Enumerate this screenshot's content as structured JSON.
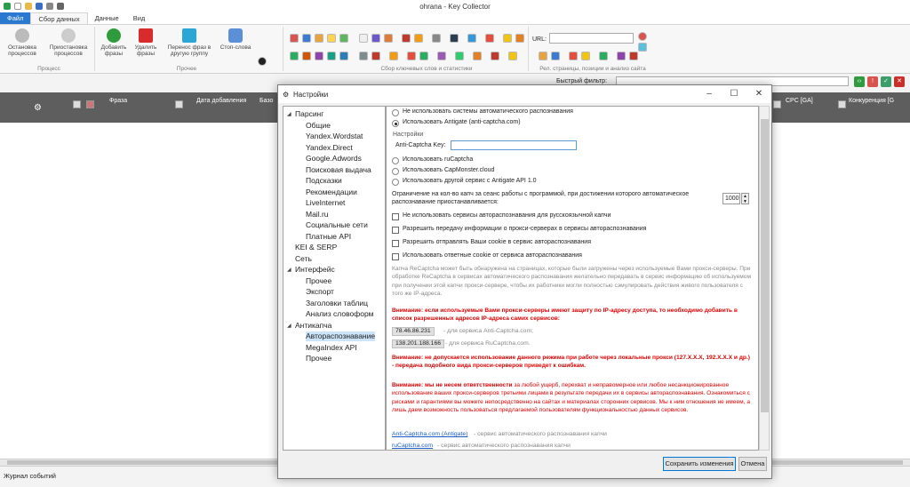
{
  "app": {
    "title": "ohrana - Key Collector"
  },
  "ribbon": {
    "tabs": [
      "Файл",
      "Сбор данных",
      "Данные",
      "Вид"
    ],
    "buttons": {
      "stop": "Остановка процессов",
      "pause": "Приостановка процессов",
      "add": "Добавить фразы",
      "delete": "Удалить фразы",
      "move": "Перенос фраз в другую группу",
      "stopwords": "Стоп-слова"
    },
    "groups": {
      "process": "Процесс",
      "other": "Прочее",
      "collect": "Сбор ключевых слов и статистики",
      "rel": "Рел. страницы, позиции и анализ сайта"
    },
    "url_label": "URL:"
  },
  "filter": {
    "label": "Быстрый фильтр:"
  },
  "grid": {
    "headers": {
      "phrase": "Фраза",
      "date": "Дата добавления",
      "base": "Базо",
      "cpc": "CPC [GA]",
      "competition": "Конкуренция [G"
    }
  },
  "status": {
    "journal": "Журнал событий"
  },
  "dialog": {
    "title": "Настройки",
    "tree": [
      {
        "label": "Парсинг",
        "level": 0,
        "expanded": true
      },
      {
        "label": "Общие",
        "level": 1
      },
      {
        "label": "Yandex.Wordstat",
        "level": 1
      },
      {
        "label": "Yandex.Direct",
        "level": 1
      },
      {
        "label": "Google.Adwords",
        "level": 1
      },
      {
        "label": "Поисковая выдача",
        "level": 1
      },
      {
        "label": "Подсказки",
        "level": 1
      },
      {
        "label": "Рекомендации",
        "level": 1
      },
      {
        "label": "LiveInternet",
        "level": 1
      },
      {
        "label": "Mail.ru",
        "level": 1
      },
      {
        "label": "Социальные сети",
        "level": 1
      },
      {
        "label": "Платные API",
        "level": 1
      },
      {
        "label": "KEI & SERP",
        "level": 0
      },
      {
        "label": "Сеть",
        "level": 0
      },
      {
        "label": "Интерфейс",
        "level": 0,
        "expanded": true
      },
      {
        "label": "Прочее",
        "level": 1
      },
      {
        "label": "Экспорт",
        "level": 1
      },
      {
        "label": "Заголовки таблиц",
        "level": 1
      },
      {
        "label": "Анализ словоформ",
        "level": 1
      },
      {
        "label": "Антикапча",
        "level": 0,
        "expanded": true
      },
      {
        "label": "Автораспознавание",
        "level": 1,
        "selected": true
      },
      {
        "label": "MegaIndex API",
        "level": 1
      },
      {
        "label": "Прочее",
        "level": 1
      }
    ],
    "content": {
      "radio_none": "Не использовать системы автоматического распознавания",
      "radio_antigate": "Использовать Antigate (anti-captcha.com)",
      "settings_label": "Настройки",
      "key_label": "Anti-Captcha Key:",
      "key_value": "",
      "radio_rucaptcha": "Использовать ruCaptcha",
      "radio_capmonster": "Использовать CapMonster.cloud",
      "radio_other": "Использовать другой сервис с Antigate API 1.0",
      "limit_text_1": "Ограничение на кол-во капч за сеанс работы с программой, при достижении которого автоматическое",
      "limit_text_2": "распознавание приостанавливается:",
      "limit_value": "1000",
      "chk_1": "Не использовать сервисы автораспознавания для русскоязычной капчи",
      "chk_2": "Разрешить передачу информации о прокси-серверах в сервисы автораспознавания",
      "chk_3": "Разрешить отправлять Ваши cookie в сервис автораспознавания",
      "chk_4": "Использовать ответные cookie от сервиса автораспознавания",
      "info": "Капча ReCaptcha может быть обнаружена на страницах, которые были загружены через используемые Вами прокси-серверы. При обработке ReCaptcha в сервисах автоматического распознавания желательно передавать в сервис информацию об используемом при получении этой капчи прокси-сервере, чтобы их работники могли полностью сэмулировать действия живого пользователя с того же IP-адреса.",
      "warn_1": "Внимание: если используемые Вами прокси-серверы имеют защиту по IP-адресу доступа, то необходимо добавить в список разрешенных адресов IP-адреса самих сервисов:",
      "ip_1": "78.46.86.231",
      "ip_1_label": "- для сервиса Anti-Captcha.com;",
      "ip_2": "138.201.188.166",
      "ip_2_label": "- для сервиса RuCaptcha.com.",
      "warn_2": "Внимание: не допускается использование данного режима при работе через локальные прокси (127.X.X.X, 192.X.X.X и др.) - передача подобного вида прокси-серверов приведет к ошибкам.",
      "warn_3_bold": "Внимание: мы не несем ответственности",
      "warn_3_rest": " за любой ущерб, перехват и неправомерное или любое несанкционированное использование ваших прокси-серверов третьими лицами в результате передачи их в сервисы автораспознавания. Ознакомиться с рисками и гарантиями вы можете непосредственно на сайтах и материалах сторонних сервисов. Мы к ним отношения не имеем, а лишь даем возможность пользоваться предлагаемой пользователям функциональностью данных сервисов.",
      "link_1": "Anti-Captcha.com (Antigate)",
      "link_1_tail": "- сервис автоматического распознавания капчи",
      "link_2": "ruCaptcha.com",
      "link_2_tail": "- сервис автоматического распознавания капчи"
    },
    "buttons": {
      "save": "Сохранить изменения",
      "cancel": "Отмена"
    }
  },
  "colors": {
    "accent": "#2b78d0",
    "warning": "#e00000",
    "link": "#1a5cc8",
    "grid_header": "#5e5e5e"
  }
}
